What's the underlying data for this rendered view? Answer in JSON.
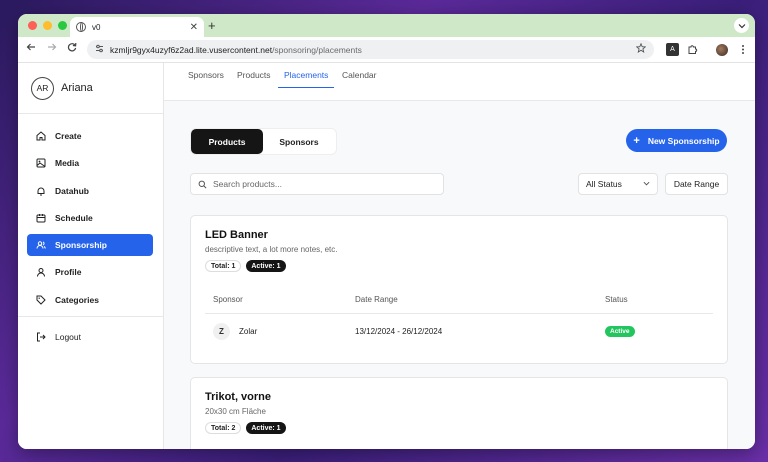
{
  "browser": {
    "tab_title": "v0",
    "tab_close": "✕",
    "new_tab": "+",
    "url_host": "kzmljr9gyx4uzyf6z2ad.lite.vusercontent.net",
    "url_path": "/sponsoring/placements"
  },
  "sidebar": {
    "avatar_initials": "AR",
    "user_name": "Ariana",
    "items": [
      {
        "label": "Create",
        "icon": "home-icon"
      },
      {
        "label": "Media",
        "icon": "image-icon"
      },
      {
        "label": "Datahub",
        "icon": "bell-icon"
      },
      {
        "label": "Schedule",
        "icon": "calendar-icon"
      },
      {
        "label": "Sponsorship",
        "icon": "users-icon",
        "active": true
      },
      {
        "label": "Profile",
        "icon": "user-icon"
      },
      {
        "label": "Categories",
        "icon": "tag-icon"
      }
    ],
    "logout_label": "Logout"
  },
  "topnav": {
    "tabs": [
      "Sponsors",
      "Products",
      "Placements",
      "Calendar"
    ],
    "active": "Placements"
  },
  "main": {
    "segment": {
      "products": "Products",
      "sponsors": "Sponsors",
      "active": "Products"
    },
    "new_button": "New Sponsorship",
    "search_placeholder": "Search products...",
    "status_filter": "All Status",
    "date_range": "Date Range"
  },
  "cards": [
    {
      "title": "LED Banner",
      "description": "descriptive text, a lot more notes, etc.",
      "total": "Total: 1",
      "active": "Active: 1",
      "columns": [
        "Sponsor",
        "Date Range",
        "Status"
      ],
      "rows": [
        {
          "initial": "Z",
          "sponsor": "Zolar",
          "date_range": "13/12/2024 - 26/12/2024",
          "status": "Active"
        }
      ]
    },
    {
      "title": "Trikot, vorne",
      "description": "20x30 cm Fläche",
      "total": "Total: 2",
      "active": "Active: 1"
    }
  ],
  "colors": {
    "accent": "#2563eb",
    "status_active": "#22c55e",
    "dark": "#151515"
  }
}
